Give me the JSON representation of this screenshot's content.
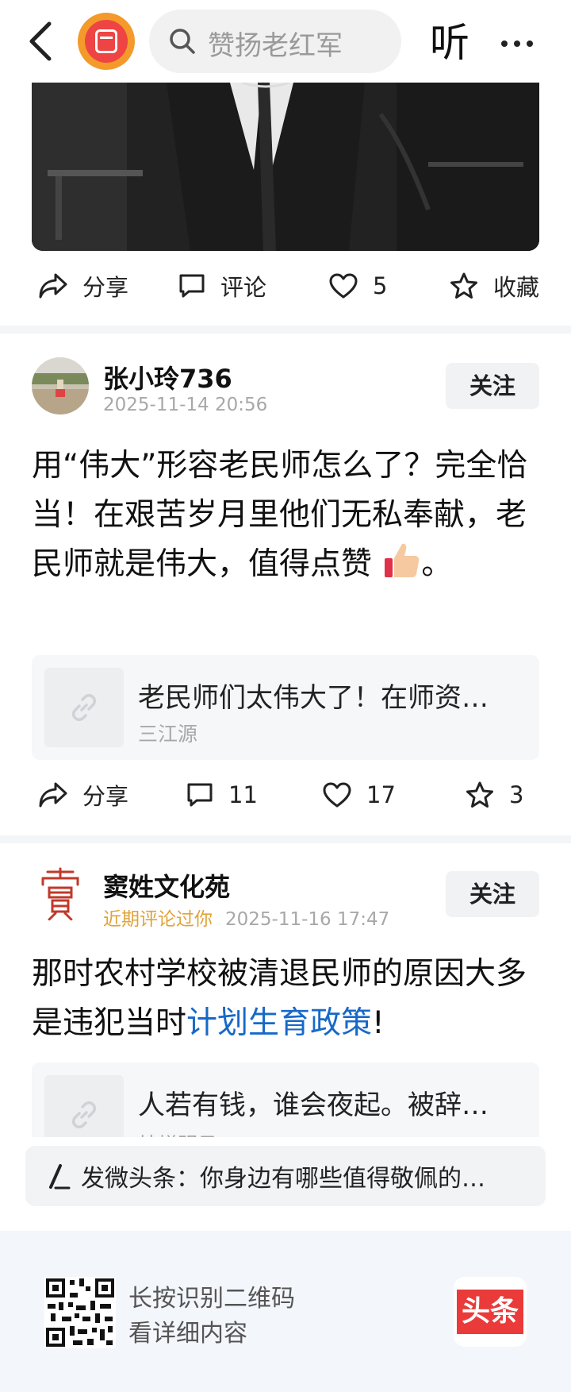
{
  "header": {
    "search_placeholder": "赞扬老红军",
    "listen_label": "听"
  },
  "first_post": {
    "actions": {
      "share": "分享",
      "comment": "评论",
      "like_count": "5",
      "favorite": "收藏"
    }
  },
  "comments": [
    {
      "username": "张小玲736",
      "time": "2025-11-14 20:56",
      "follow": "关注",
      "text": "用“伟大”形容老民师怎么了？完全恰当！在艰苦岁月里他们无私奉献，老民师就是伟大，值得点赞",
      "text_end": "。",
      "quote": {
        "title": "老民师们太伟大了！在师资…",
        "source": "三江源"
      },
      "actions": {
        "share": "分享",
        "comment_count": "11",
        "like_count": "17",
        "favorite_count": "3"
      }
    },
    {
      "username": "窦姓文化苑",
      "tag": "近期评论过你",
      "time": "2025-11-16 17:47",
      "follow": "关注",
      "text_before": "那时农村学校被清退民师的原因大多是违犯当时",
      "text_link": "计划生育政策",
      "text_after": "!",
      "quote": {
        "title": "人若有钱，谁会夜起。被辞…",
        "source": "灿烂明日DT"
      }
    }
  ],
  "post_bar": {
    "text": "发微头条：你身边有哪些值得敬佩的…"
  },
  "footer": {
    "line1": "长按识别二维码",
    "line2": "看详细内容",
    "brand": "头条"
  },
  "colors": {
    "link": "#1769c8",
    "tag": "#e0a33a",
    "brand_red": "#ea3a3a"
  }
}
